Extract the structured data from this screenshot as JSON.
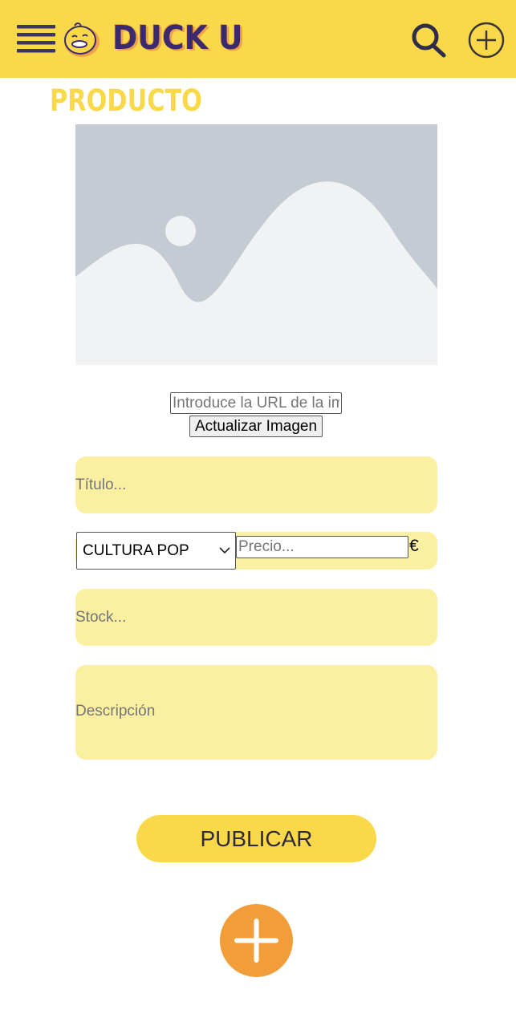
{
  "header": {
    "brand": "DUCK U",
    "menu_icon": "hamburger-menu-icon",
    "search_icon": "search-icon",
    "add_icon": "add-circle-icon",
    "background_color": "#f9d949"
  },
  "page": {
    "title": "PRODUCTO"
  },
  "image_section": {
    "url_placeholder": "Introduce la URL de la imagen",
    "update_button_label": "Actualizar Imagen"
  },
  "form": {
    "title_placeholder": "Título...",
    "category_selected": "CULTURA POP",
    "price_placeholder": "Precio...",
    "currency_symbol": "€",
    "stock_placeholder": "Stock...",
    "description_placeholder": "Descripción",
    "field_color": "#fbf0a2"
  },
  "actions": {
    "publish_label": "PUBLICAR",
    "fab_icon": "plus-icon",
    "fab_color": "#f19e3a"
  }
}
